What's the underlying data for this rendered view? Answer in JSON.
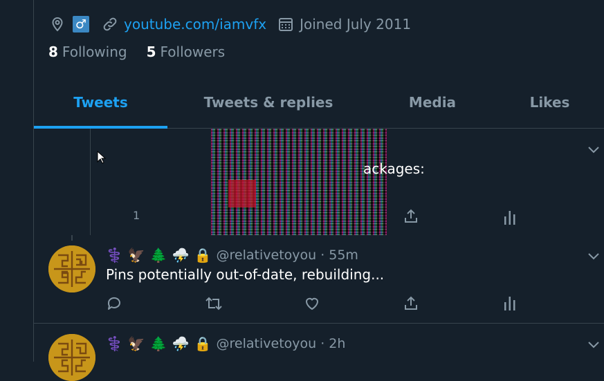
{
  "profile": {
    "gender_symbol": "♂",
    "link": "youtube.com/iamvfx",
    "joined": "Joined July 2011",
    "following_count": "8",
    "following_label": "Following",
    "followers_count": "5",
    "followers_label": "Followers"
  },
  "tabs": [
    {
      "label": "Tweets",
      "active": true
    },
    {
      "label": "Tweets & replies",
      "active": false
    },
    {
      "label": "Media",
      "active": false
    },
    {
      "label": "Likes",
      "active": false
    }
  ],
  "quoted_tweet": {
    "text_fragment": "ackages:",
    "count": "1"
  },
  "tweets": [
    {
      "emojis": [
        "⚕️",
        "🦅",
        "🌲",
        "⛈️",
        "🔒"
      ],
      "handle": "@relativetoyou",
      "separator": "·",
      "time": "55m",
      "text": "Pins potentially out-of-date, rebuilding..."
    },
    {
      "emojis": [
        "⚕️",
        "🦅",
        "🌲",
        "⛈️",
        "🔒"
      ],
      "handle": "@relativetoyou",
      "separator": "·",
      "time": "2h",
      "text": ""
    }
  ],
  "colors": {
    "background": "#15202b",
    "accent": "#1da1f2",
    "muted": "#8899a6",
    "border": "#38444d"
  },
  "icons": [
    "location-icon",
    "link-icon",
    "calendar-icon",
    "reply-icon",
    "retweet-icon",
    "like-icon",
    "share-icon",
    "analytics-icon",
    "chevron-down-icon",
    "cursor-icon"
  ]
}
